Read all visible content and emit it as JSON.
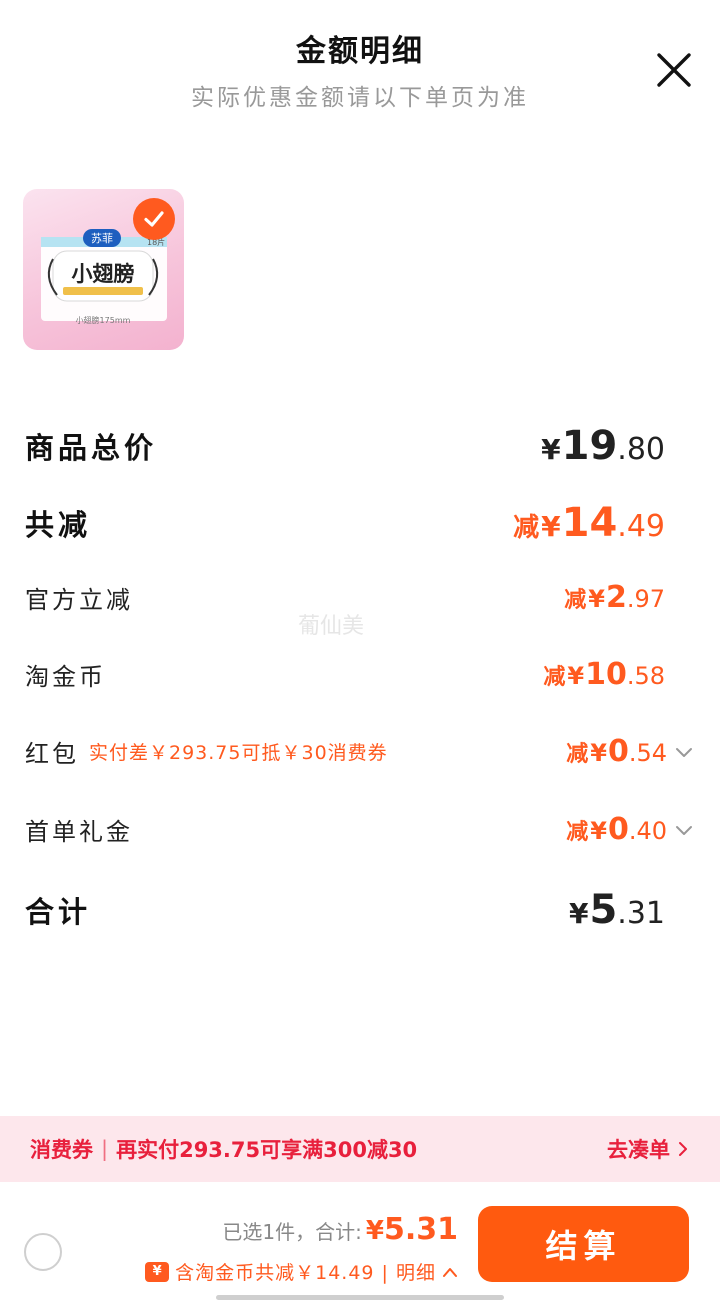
{
  "header": {
    "title": "金额明细",
    "subtitle": "实际优惠金额请以下单页为准"
  },
  "product": {
    "brand_text": "苏菲",
    "name_text": "小翅膀",
    "count_text": "18片",
    "size_text": "小翅膀175mm",
    "selected": true
  },
  "rows": {
    "total": {
      "label": "商品总价",
      "currency": "¥",
      "int": "19",
      "dec": ".80"
    },
    "discount": {
      "label": "共减",
      "prefix": "减",
      "currency": "¥",
      "int": "14",
      "dec": ".49"
    },
    "official": {
      "label": "官方立减",
      "prefix": "减",
      "currency": "¥",
      "int": "2",
      "dec": ".97"
    },
    "coins": {
      "label": "淘金币",
      "prefix": "减",
      "currency": "¥",
      "int": "10",
      "dec": ".58"
    },
    "redpack": {
      "label": "红包",
      "note": "实付差￥293.75可抵￥30消费券",
      "prefix": "减",
      "currency": "¥",
      "int": "0",
      "dec": ".54"
    },
    "first_order": {
      "label": "首单礼金",
      "prefix": "减",
      "currency": "¥",
      "int": "0",
      "dec": ".40"
    },
    "sum": {
      "label": "合计",
      "currency": "¥",
      "int": "5",
      "dec": ".31"
    }
  },
  "watermark": "葡仙美",
  "promo": {
    "tag": "消费券",
    "separator": "|",
    "message": "再实付293.75可享满300减30",
    "link": "去凑单"
  },
  "bottom": {
    "selected_text": "已选1件，合计:",
    "currency": "¥",
    "amount": "5.31",
    "coin_badge": "¥",
    "coin_text": "含淘金币共减￥14.49 | 明细",
    "checkout_label": "结算"
  },
  "colors": {
    "accent": "#ff5a1f",
    "promo_red": "#e8203c",
    "promo_bg": "#fde7ec"
  }
}
